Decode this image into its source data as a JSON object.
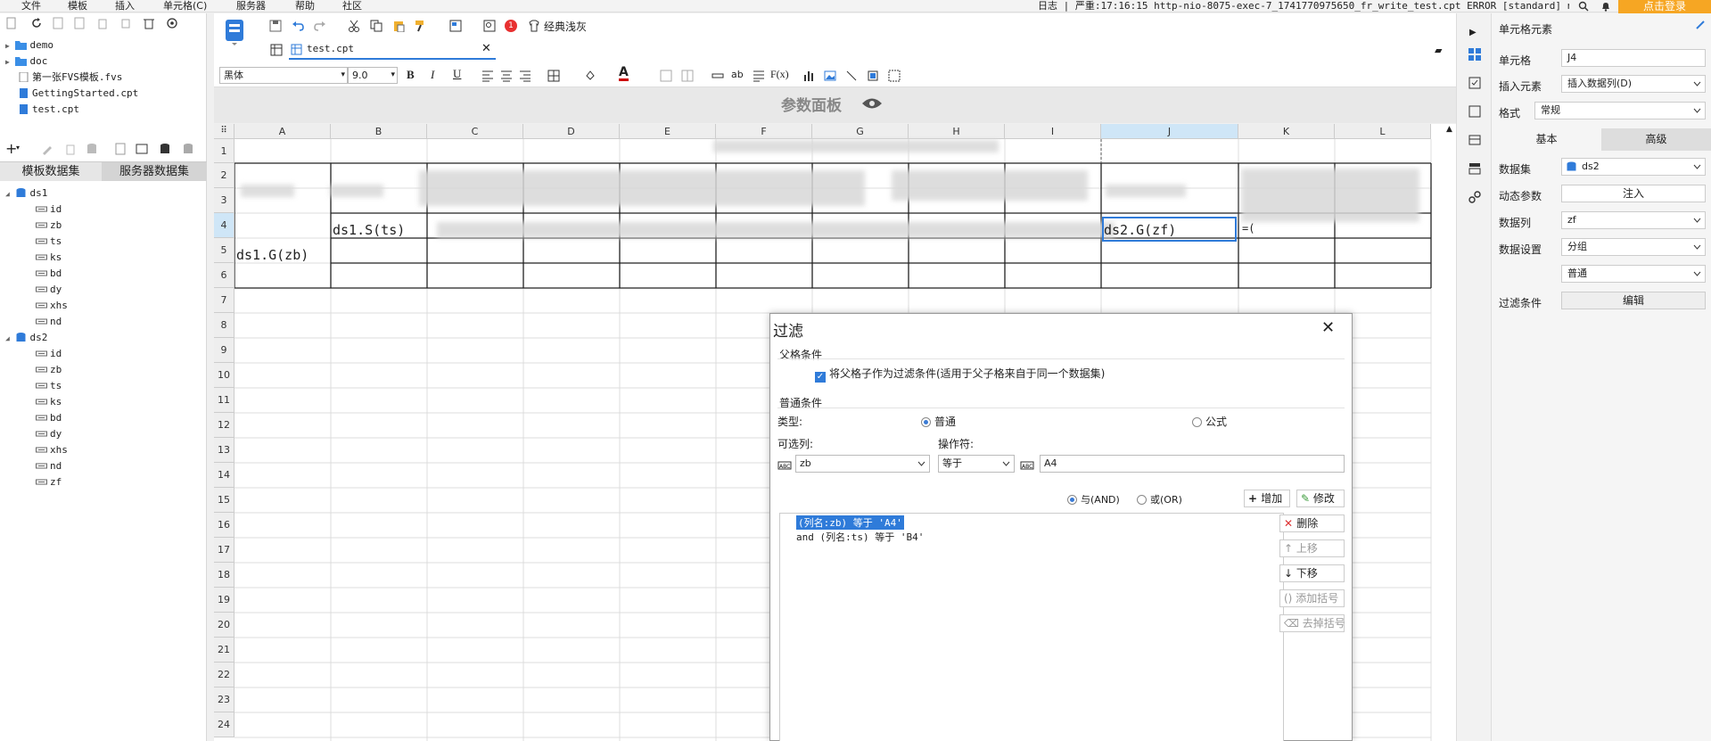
{
  "menu": {
    "items": [
      "文件",
      "模板",
      "插入",
      "单元格(C)",
      "服务器",
      "帮助",
      "社区"
    ],
    "status": "日志 | 严重:17:16:15 http-nio-8075-exec-7_1741770975650_fr_write_test.cpt ERROR [standard] not su...",
    "login": "点击登录"
  },
  "left_tree": {
    "files": [
      {
        "name": "demo",
        "icon": "folder-icon"
      },
      {
        "name": "doc",
        "icon": "folder-icon"
      },
      {
        "name": "第一张FVS模板.fvs",
        "icon": "fvs-file-icon"
      },
      {
        "name": "GettingStarted.cpt",
        "icon": "cpt-file-icon"
      },
      {
        "name": "test.cpt",
        "icon": "cpt-file-icon"
      }
    ],
    "tabs": [
      "模板数据集",
      "服务器数据集"
    ],
    "datasets": [
      {
        "name": "ds1",
        "fields": [
          "id",
          "zb",
          "ts",
          "ks",
          "bd",
          "dy",
          "xhs",
          "nd"
        ]
      },
      {
        "name": "ds2",
        "fields": [
          "id",
          "zb",
          "ts",
          "ks",
          "bd",
          "dy",
          "xhs",
          "nd",
          "zf"
        ]
      }
    ]
  },
  "tab": {
    "name": "test.cpt"
  },
  "toolbar": {
    "classic_label": "经典浅灰",
    "badge": "1",
    "font_name": "黑体",
    "font_size": "9.0",
    "param_panel": "参数面板"
  },
  "grid": {
    "columns": [
      "A",
      "B",
      "C",
      "D",
      "E",
      "F",
      "G",
      "H",
      "I",
      "J",
      "K",
      "L"
    ],
    "rows": [
      "1",
      "2",
      "3",
      "4",
      "5",
      "6",
      "7",
      "8",
      "9",
      "10",
      "11",
      "12",
      "13",
      "14",
      "15",
      "16",
      "17",
      "18",
      "19",
      "20",
      "21",
      "22",
      "23",
      "24"
    ],
    "cells": {
      "A5": "ds1.G(zb)",
      "B4": "ds1.S(ts)",
      "J4": "ds2.G(zf)",
      "K4": "=("
    }
  },
  "right": {
    "header": "单元格元素",
    "cell_label": "单元格",
    "cell_value": "J4",
    "insert_label": "插入元素",
    "insert_value": "插入数据列(D)",
    "format_label": "格式",
    "format_value": "常规",
    "tab_basic": "基本",
    "tab_advanced": "高级",
    "dataset_label": "数据集",
    "dataset_value": "ds2",
    "dyn_param_label": "动态参数",
    "dyn_param_btn": "注入",
    "datacol_label": "数据列",
    "datacol_value": "zf",
    "dataset_setting_label": "数据设置",
    "dataset_setting_value": "分组",
    "dataset_setting_value2": "普通",
    "filter_label": "过滤条件",
    "filter_btn": "编辑"
  },
  "dialog": {
    "title": "过滤",
    "parent_section": "父格条件",
    "parent_checkbox": "将父格子作为过滤条件(适用于父子格来自于同一个数据集)",
    "normal_section": "普通条件",
    "type_label": "类型:",
    "type_normal": "普通",
    "type_formula": "公式",
    "optional_col_label": "可选列:",
    "operator_label": "操作符:",
    "column_value": "zb",
    "operator_value": "等于",
    "value_field": "A4",
    "and_label": "与(AND)",
    "or_label": "或(OR)",
    "add_btn": "增加",
    "modify_btn": "修改",
    "delete_btn": "删除",
    "up_btn": "上移",
    "down_btn": "下移",
    "add_paren_btn": "添加括号",
    "remove_paren_btn": "去掉括号",
    "conditions": [
      "(列名:zb) 等于 'A4'",
      "and (列名:ts) 等于 'B4'"
    ]
  },
  "colors": {
    "accent": "#2f7bd9",
    "login": "#f6a623",
    "annotation_red": "#e83030"
  }
}
